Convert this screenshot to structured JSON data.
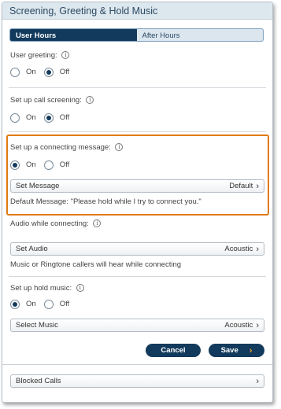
{
  "header": {
    "title": "Screening, Greeting & Hold Music"
  },
  "tabs": [
    {
      "label": "User Hours",
      "active": true
    },
    {
      "label": "After Hours",
      "active": false
    }
  ],
  "user_greeting": {
    "label": "User greeting:",
    "on": "On",
    "off": "Off",
    "selected": "Off"
  },
  "call_screening": {
    "label": "Set up call screening:",
    "on": "On",
    "off": "Off",
    "selected": "Off"
  },
  "connecting_message": {
    "label": "Set up a connecting message:",
    "on": "On",
    "off": "Off",
    "selected": "On",
    "button_label": "Set Message",
    "button_value": "Default",
    "note": "Default Message: \"Please hold while I try to connect you.\""
  },
  "audio": {
    "label": "Audio while connecting:",
    "button_label": "Set Audio",
    "button_value": "Acoustic",
    "note": "Music or Ringtone callers will hear while connecting"
  },
  "hold_music": {
    "label": "Set up hold music:",
    "on": "On",
    "off": "Off",
    "selected": "On",
    "button_label": "Select Music",
    "button_value": "Acoustic"
  },
  "actions": {
    "cancel": "Cancel",
    "save": "Save"
  },
  "blocked": {
    "label": "Blocked Calls"
  },
  "icons": {
    "info": "info-icon",
    "chevron": "chevron-right-icon",
    "save_arrow": "arrow-right-icon"
  },
  "colors": {
    "accent": "#123a5c",
    "highlight": "#e07a12",
    "header_bg": "#dde7ee"
  }
}
